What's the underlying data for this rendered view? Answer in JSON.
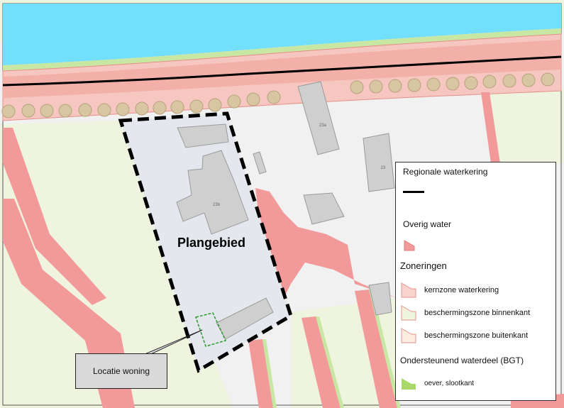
{
  "map": {
    "plan_area_label": "Plangebied",
    "building_labels": [
      "23b",
      "23a",
      "23"
    ],
    "callout_label": "Locatie woning"
  },
  "legend": {
    "regional_levee": {
      "title": "Regionale waterkering"
    },
    "other_water": {
      "title": "Overig water"
    },
    "zoning": {
      "heading": "Zoneringen",
      "items": [
        {
          "label": "kernzone waterkering"
        },
        {
          "label": "beschermingszone binnenkant"
        },
        {
          "label": "beschermingszone buitenkant"
        }
      ]
    },
    "supporting_water": {
      "heading": "Ondersteunend waterdeel (BGT)",
      "items": [
        {
          "label": "oever, slootkant"
        }
      ]
    }
  },
  "colors": {
    "water": "#73dfff",
    "levee_zone": "#f6b8b0",
    "ditch": "#f29a9a",
    "grass": "#eef5dd",
    "bank_green": "#a8d86a",
    "building": "#cfcfcf",
    "plan_area": "#e3e8ef"
  }
}
